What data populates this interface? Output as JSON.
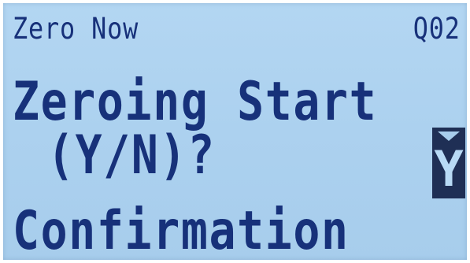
{
  "display": {
    "header_title": "Zero Now",
    "header_code": "Q02",
    "prompt_line1": "Zeroing Start",
    "prompt_line2": "(Y/N)?",
    "prompt_line3": "Confirmation",
    "selection_value": "Y",
    "selection_indicator_icon": "down-triangle-icon"
  },
  "colors": {
    "screen_background": "#acd1ef",
    "text": "#17317a",
    "selection_background": "#1f2f55"
  }
}
